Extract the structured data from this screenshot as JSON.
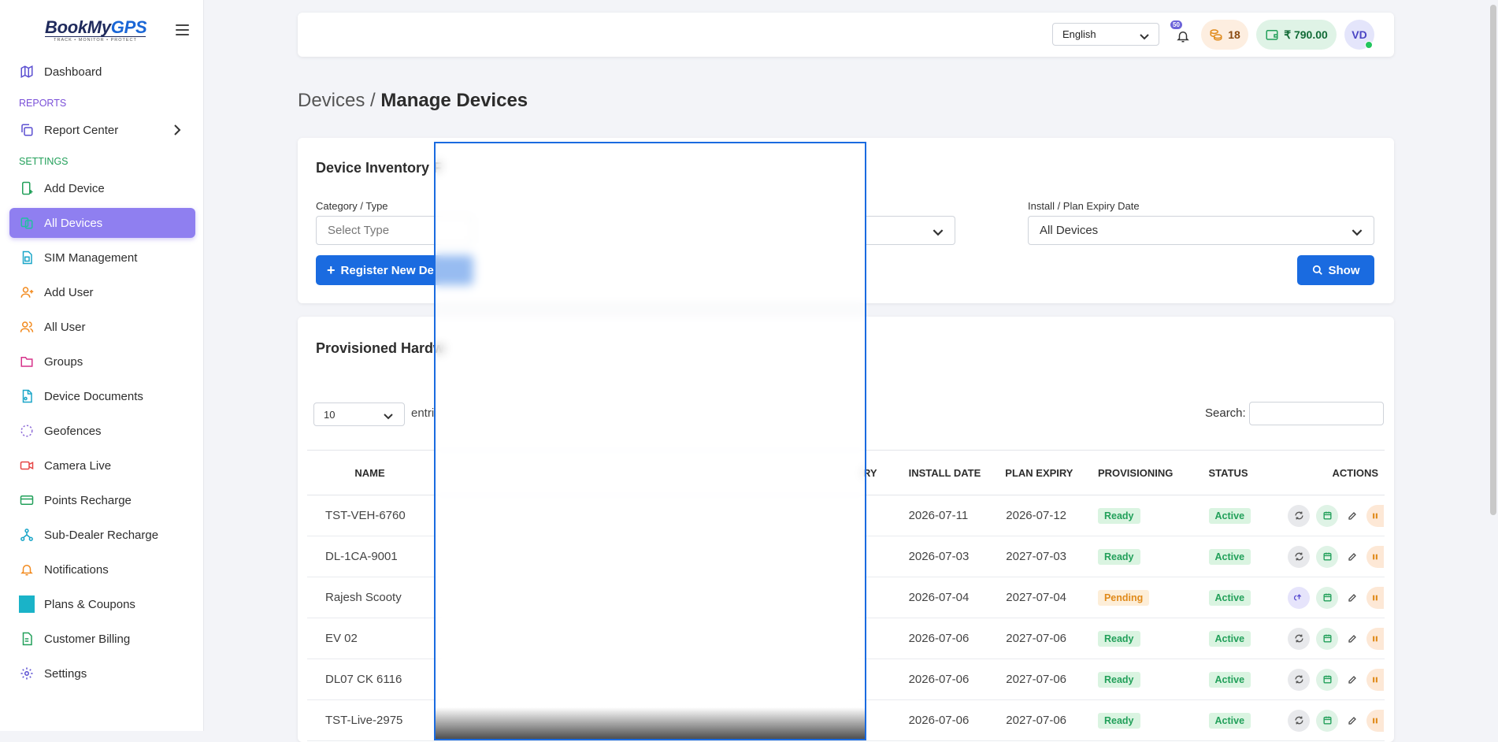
{
  "sidebar": {
    "logo": {
      "brand_a": "BookMy",
      "brand_b": "GPS",
      "tagline": "TRACK • MONITOR • PROTECT"
    },
    "items": [
      {
        "label": "Dashboard",
        "icon": "map-icon",
        "color": "#5b4fd1"
      },
      {
        "label": "Report Center",
        "icon": "copy-icon",
        "color": "#5b4fd1"
      },
      {
        "label": "Add Device",
        "icon": "add-device-icon",
        "color": "#22a05a"
      },
      {
        "label": "All Devices",
        "icon": "devices-icon",
        "color": "#ffffff"
      },
      {
        "label": "SIM Management",
        "icon": "sim-icon",
        "color": "#1aa6c8"
      },
      {
        "label": "Add User",
        "icon": "add-user-icon",
        "color": "#f28a1e"
      },
      {
        "label": "All User",
        "icon": "users-icon",
        "color": "#f28a1e"
      },
      {
        "label": "Groups",
        "icon": "folder-icon",
        "color": "#d6328a"
      },
      {
        "label": "Device Documents",
        "icon": "document-icon",
        "color": "#1aa6c8"
      },
      {
        "label": "Geofences",
        "icon": "geofence-icon",
        "color": "#8e6bd8"
      },
      {
        "label": "Camera Live",
        "icon": "camera-icon",
        "color": "#e64545"
      },
      {
        "label": "Points Recharge",
        "icon": "card-icon",
        "color": "#22a05a"
      },
      {
        "label": "Sub-Dealer Recharge",
        "icon": "share-icon",
        "color": "#1aa6c8"
      },
      {
        "label": "Notifications",
        "icon": "bell-icon",
        "color": "#f28a1e"
      },
      {
        "label": "Plans & Coupons",
        "icon": "plans-icon",
        "color": "#1aa6c8"
      },
      {
        "label": "Customer Billing",
        "icon": "billing-icon",
        "color": "#22a05a"
      },
      {
        "label": "Settings",
        "icon": "gear-icon",
        "color": "#5b4fd1"
      }
    ],
    "sections": {
      "reports": "REPORTS",
      "settings": "SETTINGS"
    }
  },
  "topbar": {
    "language": "English",
    "notifications_count": "50",
    "coins": "18",
    "wallet": "₹ 790.00",
    "avatar": "VD"
  },
  "breadcrumb": {
    "parent": "Devices /",
    "current": "Manage Devices"
  },
  "filters": {
    "title": "Device Inventory F",
    "category_label": "Category / Type",
    "category_value": "Select Type",
    "expiry_label": "Install / Plan Expiry Date",
    "expiry_value": "All Devices",
    "register_button": "Register New De",
    "show_button": "Show"
  },
  "inventory": {
    "title": "Provisioned Hardw",
    "page_size": "10",
    "entries_text": "entri",
    "search_label": "Search:",
    "columns": {
      "name": "NAME",
      "expiry_partial": "RY",
      "install": "INSTALL DATE",
      "plan": "PLAN EXPIRY",
      "provisioning": "PROVISIONING",
      "status": "STATUS",
      "actions": "ACTIONS"
    },
    "rows": [
      {
        "name": "TST-VEH-6760",
        "install": "2026-07-11",
        "plan": "2026-07-12",
        "provisioning": "Ready",
        "status": "Active"
      },
      {
        "name": "DL-1CA-9001",
        "install": "2026-07-03",
        "plan": "2027-07-03",
        "provisioning": "Ready",
        "status": "Active"
      },
      {
        "name": "Rajesh Scooty",
        "install": "2026-07-04",
        "plan": "2027-07-04",
        "provisioning": "Pending",
        "status": "Active"
      },
      {
        "name": "EV 02",
        "install": "2026-07-06",
        "plan": "2027-07-06",
        "provisioning": "Ready",
        "status": "Active"
      },
      {
        "name": "DL07 CK 6116",
        "install": "2026-07-06",
        "plan": "2027-07-06",
        "provisioning": "Ready",
        "status": "Active"
      },
      {
        "name": "TST-Live-2975",
        "install": "2026-07-06",
        "plan": "2027-07-06",
        "provisioning": "Ready",
        "status": "Active"
      }
    ]
  }
}
